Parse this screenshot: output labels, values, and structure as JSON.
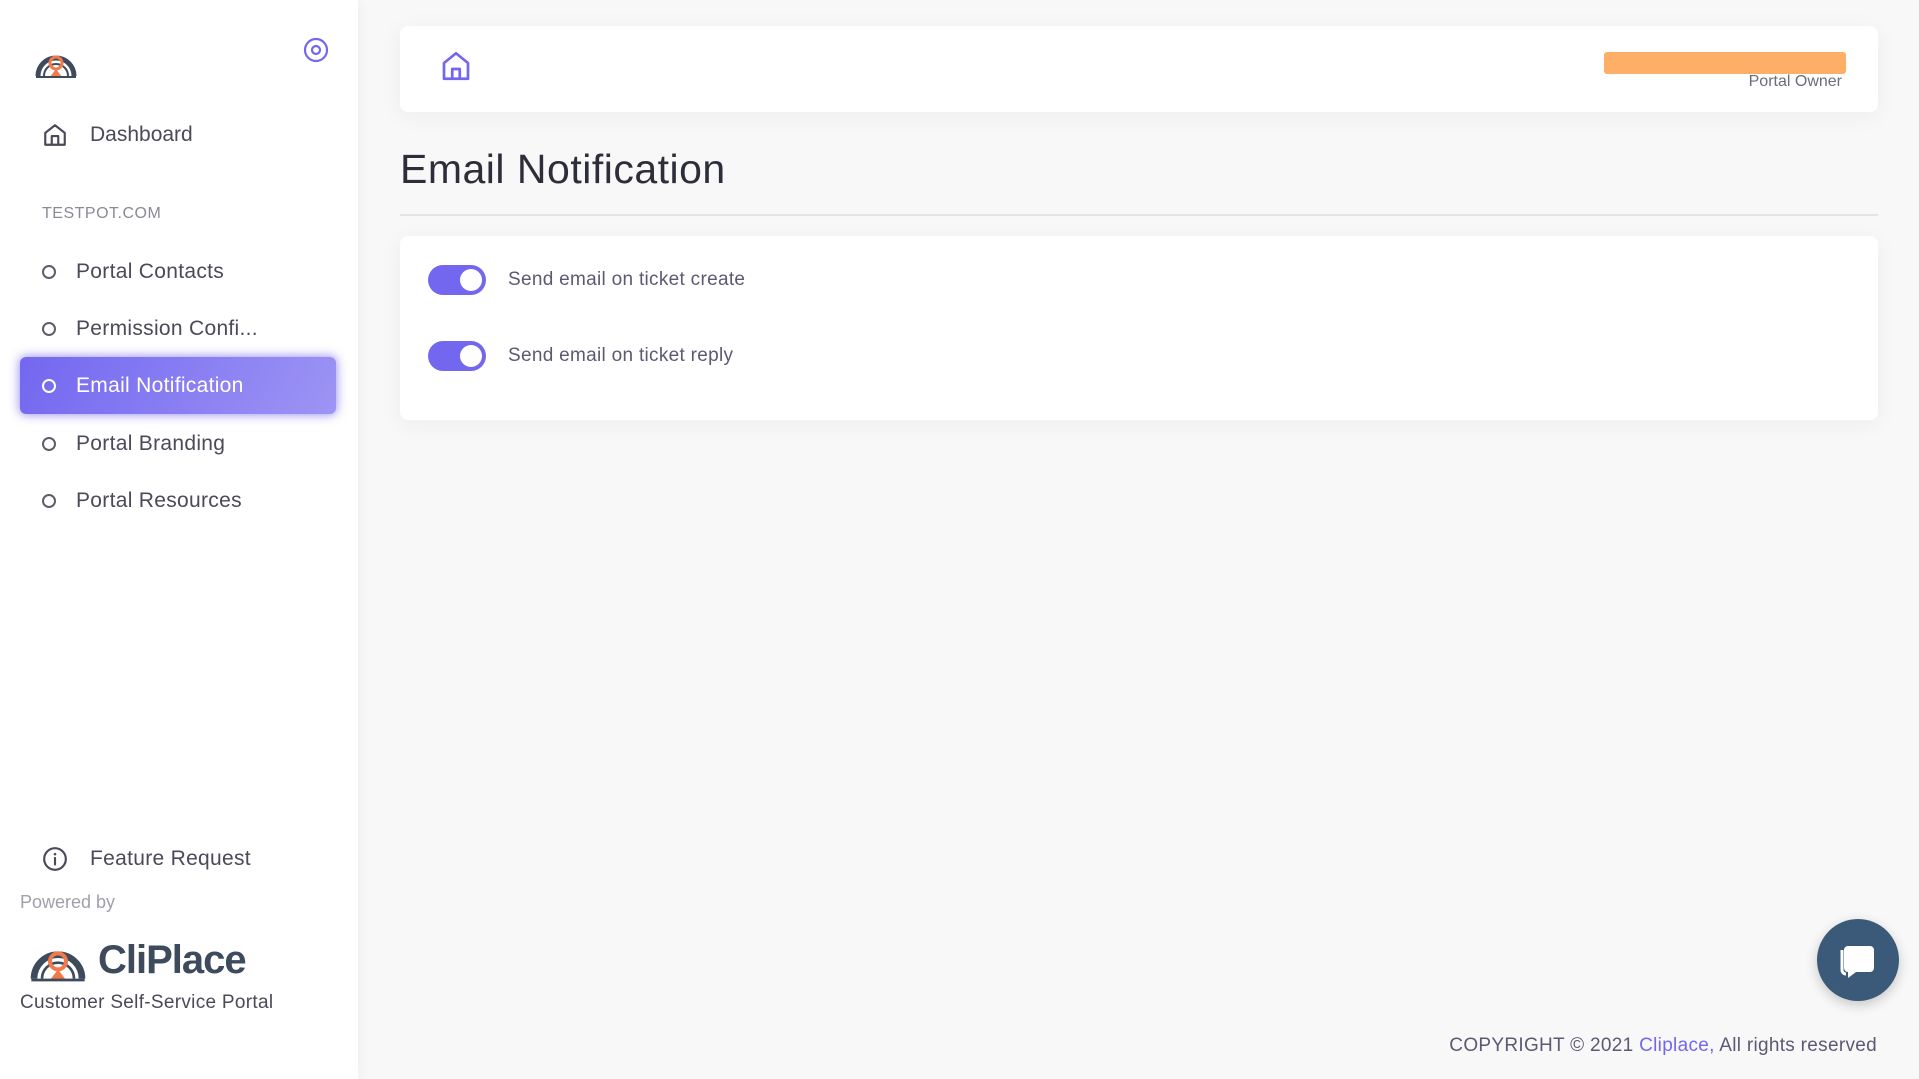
{
  "sidebar": {
    "dashboard_label": "Dashboard",
    "section_header": "TESTPOT.COM",
    "items": [
      {
        "label": "Portal Contacts",
        "active": false
      },
      {
        "label": "Permission Confi...",
        "active": false
      },
      {
        "label": "Email Notification",
        "active": true
      },
      {
        "label": "Portal Branding",
        "active": false
      },
      {
        "label": "Portal Resources",
        "active": false
      }
    ],
    "feature_request_label": "Feature Request",
    "powered_by": "Powered by",
    "brand_wordmark": "CliPlace",
    "tagline": "Customer Self-Service Portal"
  },
  "header": {
    "user_role": "Portal Owner"
  },
  "main": {
    "page_title": "Email Notification",
    "toggles": [
      {
        "label": "Send email on ticket create",
        "enabled": true
      },
      {
        "label": "Send email on ticket reply",
        "enabled": true
      }
    ]
  },
  "footer": {
    "copyright_prefix": "COPYRIGHT © 2021",
    "link_text": "Cliplace,",
    "suffix": "All rights reserved"
  },
  "colors": {
    "accent": "#7367f0",
    "redaction": "#fdae67",
    "chat": "#3b5a7a"
  }
}
